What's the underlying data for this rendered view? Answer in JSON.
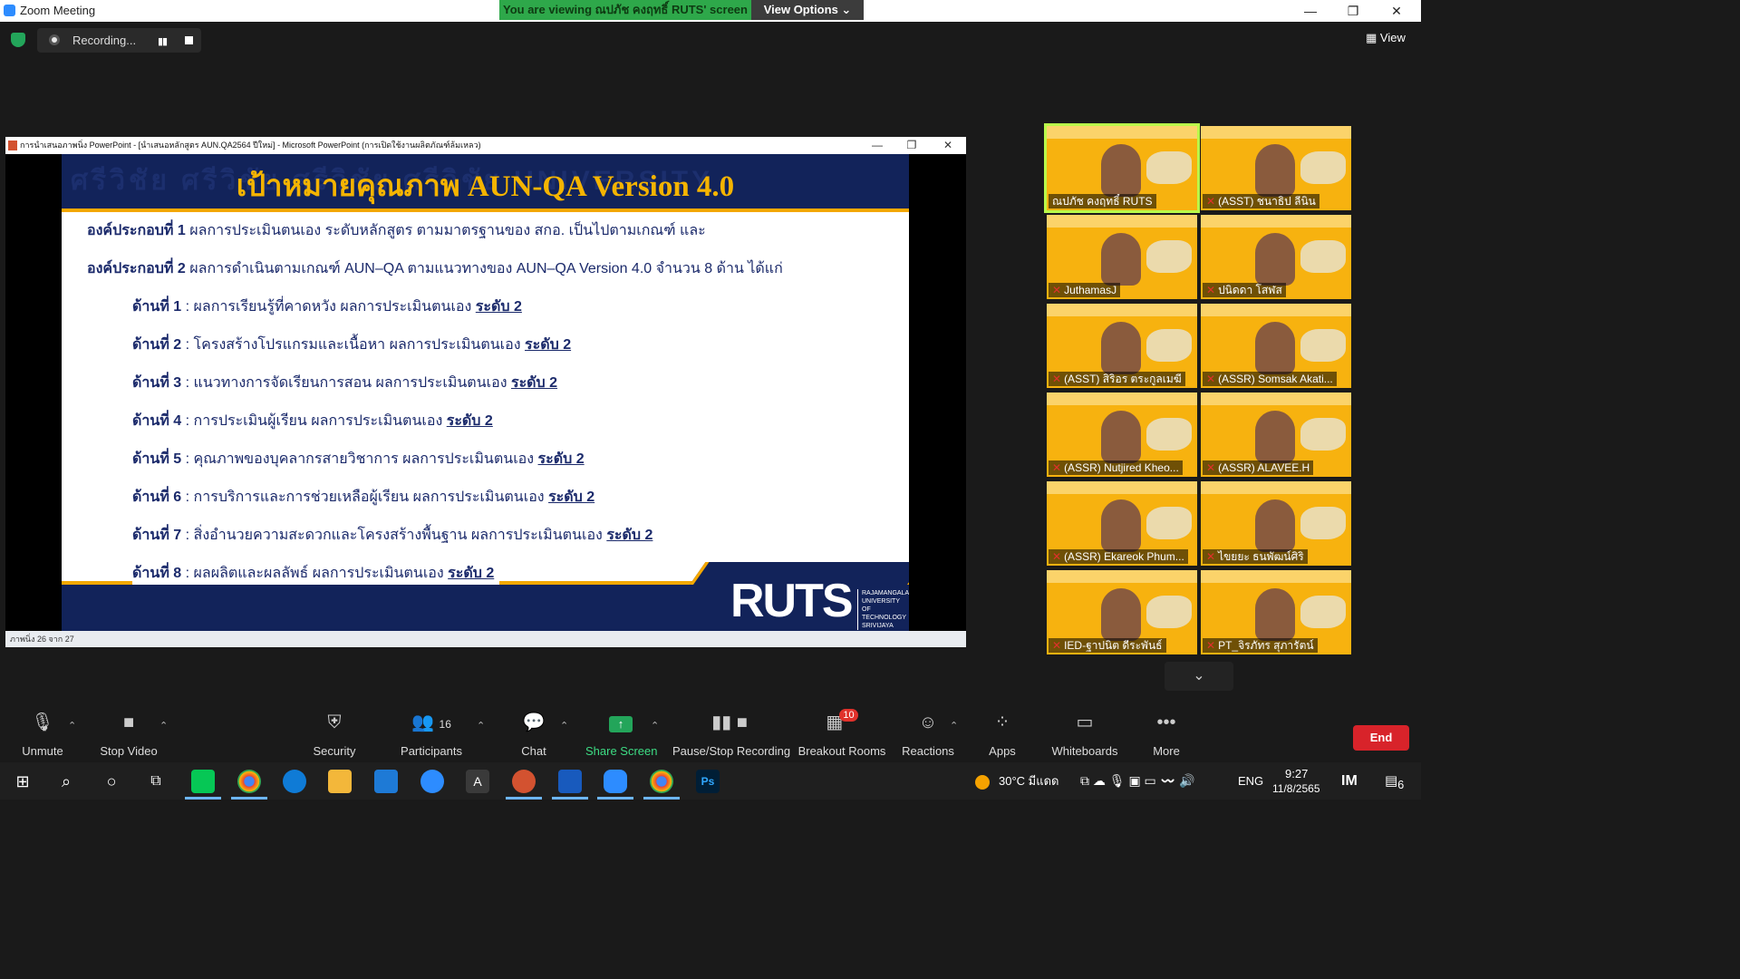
{
  "window": {
    "app_title": "Zoom Meeting",
    "minimize": "—",
    "restore": "❐",
    "close": "✕"
  },
  "share_banner": {
    "viewing_text": "You are viewing ณปภัช คงฤทธิ์ RUTS' screen",
    "view_options": "View Options ⌄"
  },
  "recording": {
    "label": "Recording...",
    "pause": "▮▮"
  },
  "view_button": "▦ View",
  "powerpoint": {
    "title": "การนำเสนอภาพนิ่ง PowerPoint - [นำเสนอหลักสูตร AUN.QA2564 ปีใหม่] - Microsoft PowerPoint (การเปิดใช้งานผลิตภัณฑ์ล้มเหลว)",
    "status": "ภาพนิ่ง 26 จาก 27",
    "minimize": "—",
    "restore": "❐",
    "close": "✕"
  },
  "slide": {
    "bg_text": "ศรีวิชัย ศรีวิชัย ศรีวิชัย ศรีวิชัย UNIVERSITY",
    "title": "เป้าหมายคุณภาพ AUN-QA Version 4.0",
    "component1_head": "องค์ประกอบที่ 1",
    "component1_text": "ผลการประเมินตนเอง ระดับหลักสูตร ตามมาตรฐานของ สกอ. เป็นไปตามเกณฑ์ และ",
    "component2_head": "องค์ประกอบที่ 2",
    "component2_text": "ผลการดำเนินตามเกณฑ์ AUN–QA ตามแนวทางของ AUN–QA Version 4.0 จำนวน 8 ด้าน ได้แก่",
    "level": "ระดับ 2",
    "items": [
      {
        "head": "ด้านที่ 1",
        "text": ": ผลการเรียนรู้ที่คาดหวัง ผลการประเมินตนเอง"
      },
      {
        "head": "ด้านที่ 2",
        "text": ": โครงสร้างโปรแกรมและเนื้อหา ผลการประเมินตนเอง"
      },
      {
        "head": "ด้านที่ 3",
        "text": ": แนวทางการจัดเรียนการสอน ผลการประเมินตนเอง"
      },
      {
        "head": "ด้านที่ 4",
        "text": ": การประเมินผู้เรียน ผลการประเมินตนเอง"
      },
      {
        "head": "ด้านที่ 5",
        "text": ": คุณภาพของบุคลากรสายวิชาการ ผลการประเมินตนเอง"
      },
      {
        "head": "ด้านที่ 6",
        "text": ": การบริการและการช่วยเหลือผู้เรียน ผลการประเมินตนเอง"
      },
      {
        "head": "ด้านที่ 7",
        "text": ": สิ่งอำนวยความสะดวกและโครงสร้างพื้นฐาน ผลการประเมินตนเอง"
      },
      {
        "head": "ด้านที่ 8",
        "text": ": ผลผลิตและผลลัพธ์ ผลการประเมินตนเอง"
      }
    ],
    "logo": "RUTS",
    "logo_sub_1": "RAJAMANGALA",
    "logo_sub_2": "UNIVERSITY",
    "logo_sub_3": "OF TECHNOLOGY",
    "logo_sub_4": "SRIVIJAYA"
  },
  "participants_gallery": [
    {
      "name": "ณปภัช คงฤทธิ์ RUTS",
      "muted": false
    },
    {
      "name": "(ASST) ชนาธิป ลีนิน",
      "muted": true
    },
    {
      "name": "JuthamasJ",
      "muted": true
    },
    {
      "name": "ปนิดดา โสฬส",
      "muted": true
    },
    {
      "name": "(ASST) สิริอร ตระกูลเมฆี",
      "muted": true
    },
    {
      "name": "(ASSR) Somsak Akati...",
      "muted": true
    },
    {
      "name": "(ASSR) Nutjired Kheo...",
      "muted": true
    },
    {
      "name": "(ASSR) ALAVEE.H",
      "muted": true
    },
    {
      "name": "(ASSR) Ekareok Phum...",
      "muted": true
    },
    {
      "name": "ไขยยะ ธนพัฒน์ศิริ",
      "muted": true
    },
    {
      "name": "IED-ฐาปนิต ดีระพันธ์",
      "muted": true
    },
    {
      "name": "PT_จิรภัทร สุภารัตน์",
      "muted": true
    }
  ],
  "scroll_down": "⌄",
  "toolbar": {
    "unmute": "Unmute",
    "stop_video": "Stop Video",
    "security": "Security",
    "participants": "Participants",
    "participants_count": "16",
    "chat": "Chat",
    "share_screen": "Share Screen",
    "pause_stop_recording": "Pause/Stop Recording",
    "breakout_rooms": "Breakout Rooms",
    "breakout_badge": "10",
    "reactions": "Reactions",
    "apps": "Apps",
    "whiteboards": "Whiteboards",
    "more": "More",
    "end": "End"
  },
  "taskbar": {
    "weather": "30°C มีแดด",
    "lang": "ENG",
    "time": "9:27",
    "date": "11/8/2565",
    "notifications": "6"
  },
  "colors": {
    "accent_green": "#2ea84a",
    "end_red": "#d8232a",
    "slide_navy": "#12235a",
    "slide_gold": "#f5a800",
    "tile_yellow": "#f7b20f"
  }
}
